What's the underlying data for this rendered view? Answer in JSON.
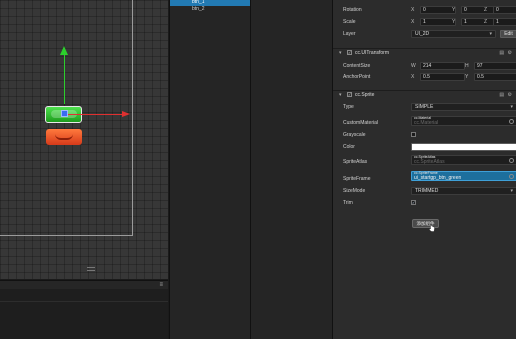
{
  "hierarchy": {
    "items": [
      {
        "label": "btn_1",
        "selected": true
      },
      {
        "label": "btn_2",
        "selected": false
      }
    ]
  },
  "inspector": {
    "rotation": {
      "label": "Rotation",
      "x": "0",
      "y": "0",
      "z": "0"
    },
    "scale": {
      "label": "Scale",
      "x": "1",
      "y": "1",
      "z": "1"
    },
    "layer": {
      "label": "Layer",
      "value": "UI_2D",
      "edit_label": "Edit"
    },
    "uitransform": {
      "title": "cc.UITransform",
      "content_size": {
        "label": "ContentSize",
        "w": "214",
        "h": "97"
      },
      "anchor_point": {
        "label": "AnchorPoint",
        "x": "0.5",
        "y": "0.5"
      }
    },
    "sprite": {
      "title": "cc.Sprite",
      "type": {
        "label": "Type",
        "value": "SIMPLE"
      },
      "custom_material": {
        "label": "CustomMaterial",
        "asset_type": "cc.Material",
        "asset_name": "cc.Material"
      },
      "grayscale": {
        "label": "Grayscale"
      },
      "color": {
        "label": "Color",
        "hex": "#ffffff"
      },
      "sprite_atlas": {
        "label": "SpriteAtlas",
        "asset_type": "cc.SpriteAtlas",
        "asset_name": "cc.SpriteAtlas"
      },
      "sprite_frame": {
        "label": "SpriteFrame",
        "asset_type": "cc.SpriteFrame",
        "asset_name": "ui_startgp_btn_green"
      },
      "size_mode": {
        "label": "SizeMode",
        "value": "TRIMMED"
      },
      "trim": {
        "label": "Trim"
      }
    },
    "add_component_label": "添加组件"
  },
  "axis_labels": {
    "x": "X",
    "y": "Y",
    "z": "Z",
    "w": "W",
    "h": "H"
  },
  "icons": {
    "component_help": "book-icon",
    "component_settings": "gear-icon",
    "console_menu": "menu-icon"
  },
  "colors": {
    "selection": "#227ab3",
    "sprite_frame_field": "#1d6f9d",
    "gizmo_y": "#2ccf2c",
    "gizmo_x": "#e03030"
  }
}
